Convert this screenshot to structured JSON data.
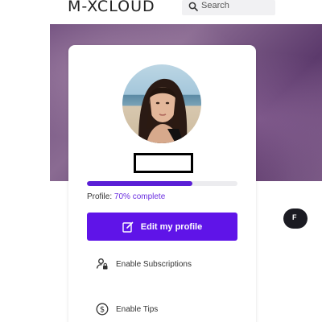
{
  "header": {
    "logo_text": "M-XCLOUD",
    "search_placeholder": "Search"
  },
  "profile": {
    "status_prefix": "Profile: ",
    "completion_text": "70% complete",
    "completion_fraction": 0.7,
    "edit_button_label": "Edit my profile"
  },
  "menu": {
    "items": [
      {
        "label": "Enable Subscriptions",
        "icon": "user-lock-icon"
      },
      {
        "label": "Enable Tips",
        "icon": "dollar-circle-icon"
      }
    ]
  },
  "side_pill": {
    "label": "F"
  },
  "colors": {
    "accent": "#5f14e8",
    "progress_fill": "#5a1fd6",
    "progress_track": "#ececef",
    "pill_bg": "#1b1b22"
  }
}
